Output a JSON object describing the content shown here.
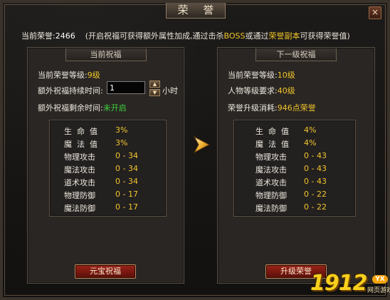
{
  "window": {
    "title": "荣 誉",
    "close_label": "×"
  },
  "header": {
    "current_honor_label": "当前荣誉:",
    "current_honor_value": "2466",
    "hint_prefix": "(开启祝福可获得额外属性加成,通过击杀",
    "hint_boss": "BOSS",
    "hint_mid": "或通过",
    "hint_instance": "荣誉副本",
    "hint_suffix": "可获得荣誉值)"
  },
  "left_panel": {
    "title": "当前祝福",
    "level_label": "当前荣誉等级:",
    "level_value": "9级",
    "duration_label": "额外祝福持续时间:",
    "duration_value": "1",
    "duration_unit": "小时",
    "remaining_label": "额外祝福剩余时间:",
    "remaining_value": "未开启",
    "stats": [
      {
        "name": "生命值",
        "value": "3%"
      },
      {
        "name": "魔法值",
        "value": "3%"
      },
      {
        "name": "物理攻击",
        "value": "0 - 34"
      },
      {
        "name": "魔法攻击",
        "value": "0 - 34"
      },
      {
        "name": "道术攻击",
        "value": "0 - 34"
      },
      {
        "name": "物理防御",
        "value": "0 - 17"
      },
      {
        "name": "魔法防御",
        "value": "0 - 17"
      }
    ],
    "button_label": "元宝祝福"
  },
  "right_panel": {
    "title": "下一级祝福",
    "level_label": "当前荣誉等级:",
    "level_value": "10级",
    "req_label": "人物等级要求:",
    "req_value": "40级",
    "cost_label": "荣誉升级消耗:",
    "cost_value": "946点荣誉",
    "stats": [
      {
        "name": "生命值",
        "value": "4%"
      },
      {
        "name": "魔法值",
        "value": "4%"
      },
      {
        "name": "物理攻击",
        "value": "0 - 43"
      },
      {
        "name": "魔法攻击",
        "value": "0 - 43"
      },
      {
        "name": "道术攻击",
        "value": "0 - 43"
      },
      {
        "name": "物理防御",
        "value": "0 - 22"
      },
      {
        "name": "魔法防御",
        "value": "0 - 22"
      }
    ],
    "button_label": "升级荣誉"
  },
  "watermark": {
    "number": "1912",
    "badge": "YX",
    "sub": "网页游戏"
  },
  "colors": {
    "gold_value": "#f0c52b",
    "green_value": "#3ed13e",
    "red_unit": "#e32a1a",
    "button_red": "#9b2318"
  },
  "icons": {
    "arrow": "right-arrow-icon",
    "stepper_up": "triangle-up-icon",
    "stepper_down": "triangle-down-icon"
  }
}
